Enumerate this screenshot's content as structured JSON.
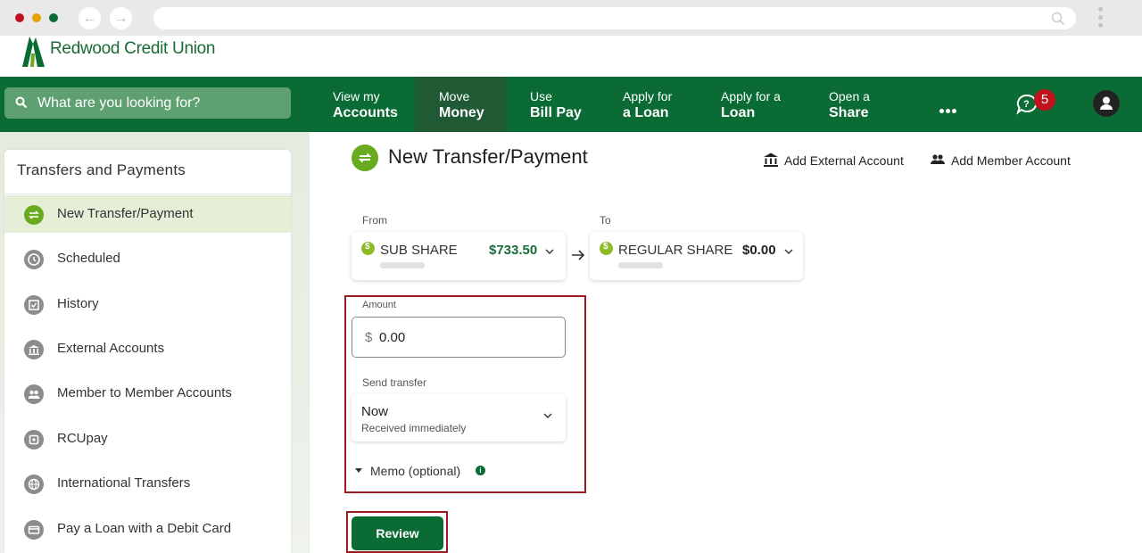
{
  "brand": {
    "name": "Redwood Credit Union",
    "primary_color": "#0b6b34",
    "accent_color": "#6aaa1e",
    "highlight_color": "#9b1c1f"
  },
  "search": {
    "placeholder": "What are you looking for?"
  },
  "nav": {
    "items": [
      {
        "line1": "View my",
        "line2": "Accounts"
      },
      {
        "line1": "Move",
        "line2": "Money"
      },
      {
        "line1": "Use",
        "line2": "Bill Pay"
      },
      {
        "line1": "Apply for",
        "line2": "a Loan"
      },
      {
        "line1": "Apply for a",
        "line2": "Loan"
      },
      {
        "line1": "Open a",
        "line2": "Share"
      }
    ],
    "notification_count": "5"
  },
  "sidebar": {
    "title": "Transfers and Payments",
    "items": [
      {
        "label": "New Transfer/Payment",
        "icon": "transfer-arrows-icon"
      },
      {
        "label": "Scheduled",
        "icon": "clock-icon"
      },
      {
        "label": "History",
        "icon": "calendar-check-icon"
      },
      {
        "label": "External Accounts",
        "icon": "bank-icon"
      },
      {
        "label": "Member to Member Accounts",
        "icon": "people-icon"
      },
      {
        "label": "RCUpay",
        "icon": "rcupay-icon"
      },
      {
        "label": "International Transfers",
        "icon": "globe-icon"
      },
      {
        "label": "Pay a Loan with a Debit Card",
        "icon": "card-icon"
      }
    ]
  },
  "main": {
    "title": "New Transfer/Payment",
    "add_external": "Add External Account",
    "add_member": "Add Member Account",
    "from": {
      "label": "From",
      "account": "SUB SHARE",
      "balance": "$733.50"
    },
    "to": {
      "label": "To",
      "account": "REGULAR SHARE",
      "balance": "$0.00"
    },
    "amount": {
      "label": "Amount",
      "currency": "$",
      "value": "0.00"
    },
    "send": {
      "label": "Send transfer",
      "value": "Now",
      "sub": "Received immediately"
    },
    "memo": "Memo (optional)",
    "review": "Review"
  }
}
